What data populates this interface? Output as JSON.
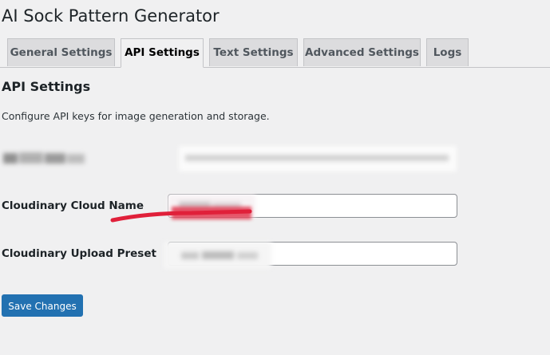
{
  "page": {
    "title": "AI Sock Pattern Generator"
  },
  "tabs": [
    {
      "label": "General Settings",
      "active": false
    },
    {
      "label": "API Settings",
      "active": true
    },
    {
      "label": "Text Settings",
      "active": false
    },
    {
      "label": "Advanced Settings",
      "active": false
    },
    {
      "label": "Logs",
      "active": false
    }
  ],
  "section": {
    "title": "API Settings",
    "description": "Configure API keys for image generation and storage."
  },
  "fields": [
    {
      "label": "",
      "value": "",
      "redacted": true
    },
    {
      "label": "Cloudinary Cloud Name",
      "value": "",
      "redacted": true
    },
    {
      "label": "Cloudinary Upload Preset",
      "value": "",
      "redacted": true
    }
  ],
  "actions": {
    "save_label": "Save Changes"
  },
  "colors": {
    "background": "#f0f0f1",
    "primary_button": "#2271b1",
    "tab_inactive": "#dcdcde",
    "annotation_stroke": "#e0203a"
  }
}
